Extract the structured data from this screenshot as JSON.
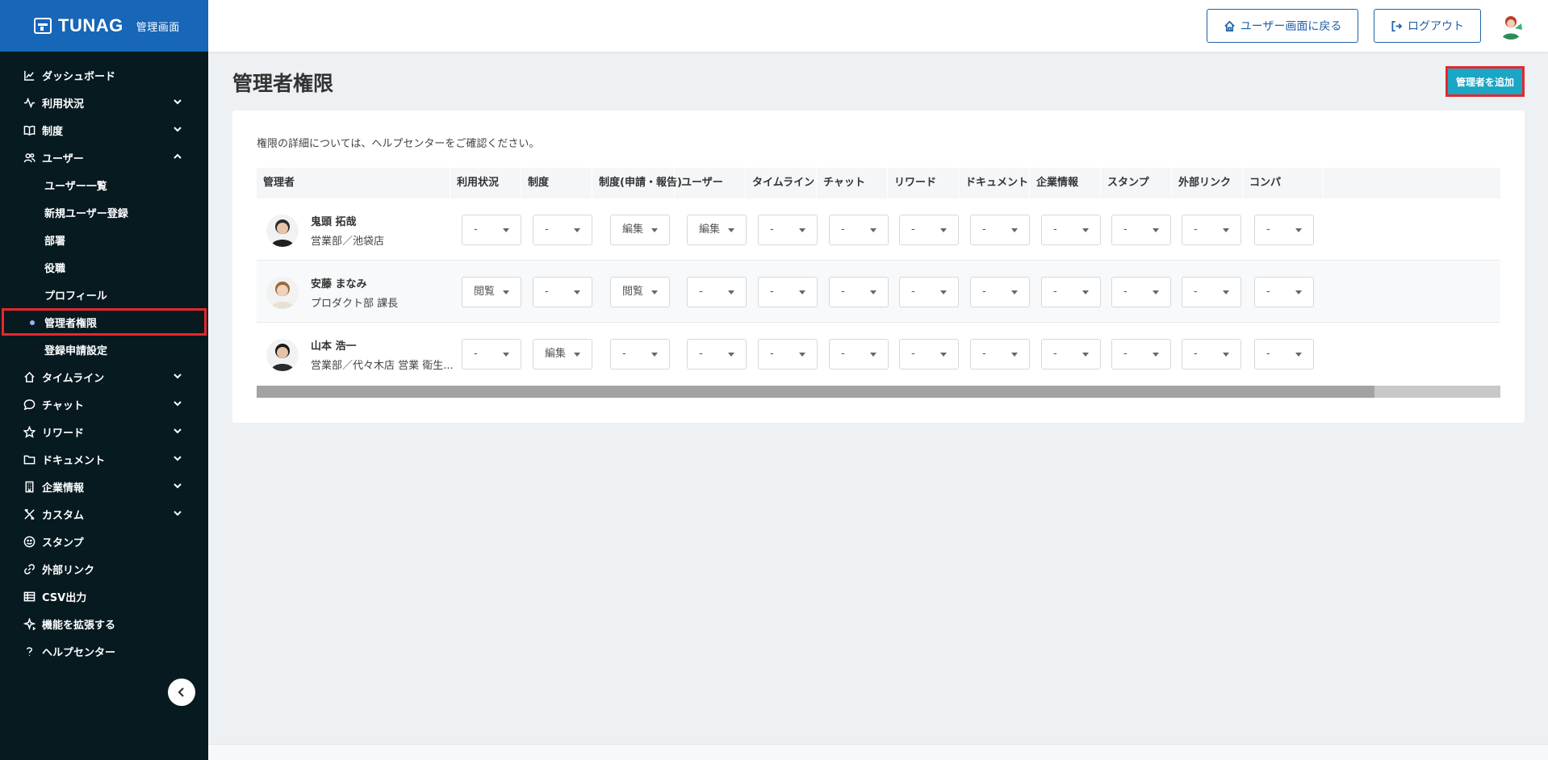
{
  "brand": {
    "name": "TUNAG",
    "sub": "管理画面"
  },
  "sidebar": {
    "items": [
      {
        "label": "ダッシュボード",
        "icon": "chart-line-icon",
        "chevron": ""
      },
      {
        "label": "利用状況",
        "icon": "activity-icon",
        "chevron": "down"
      },
      {
        "label": "制度",
        "icon": "book-icon",
        "chevron": "down"
      },
      {
        "label": "ユーザー",
        "icon": "users-icon",
        "chevron": "up",
        "children": [
          "ユーザー一覧",
          "新規ユーザー登録",
          "部署",
          "役職",
          "プロフィール",
          "管理者権限",
          "登録申請設定"
        ],
        "active_child": 5
      },
      {
        "label": "タイムライン",
        "icon": "home-icon",
        "chevron": "down"
      },
      {
        "label": "チャット",
        "icon": "chat-bubble-icon",
        "chevron": "down"
      },
      {
        "label": "リワード",
        "icon": "star-icon",
        "chevron": "down"
      },
      {
        "label": "ドキュメント",
        "icon": "folder-icon",
        "chevron": "down"
      },
      {
        "label": "企業情報",
        "icon": "building-icon",
        "chevron": "down"
      },
      {
        "label": "カスタム",
        "icon": "tools-icon",
        "chevron": "down"
      },
      {
        "label": "スタンプ",
        "icon": "smile-icon",
        "chevron": ""
      },
      {
        "label": "外部リンク",
        "icon": "link-icon",
        "chevron": ""
      },
      {
        "label": "CSV出力",
        "icon": "table-icon",
        "chevron": ""
      },
      {
        "label": "機能を拡張する",
        "icon": "sparkle-icon",
        "chevron": ""
      },
      {
        "label": "ヘルプセンター",
        "icon": "help-icon",
        "chevron": ""
      }
    ]
  },
  "header": {
    "user_screen_label": "ユーザー画面に戻る",
    "logout_label": "ログアウト"
  },
  "main": {
    "title": "管理者権限",
    "add_button": "管理者を追加",
    "help_text": "権限の詳細については、ヘルプセンターをご確認ください。"
  },
  "table": {
    "columns": [
      "管理者",
      "利用状況",
      "制度",
      "制度(申請・報告)",
      "ユーザー",
      "タイムライン",
      "チャット",
      "リワード",
      "ドキュメント",
      "企業情報",
      "スタンプ",
      "外部リンク",
      "コンパ"
    ],
    "rows": [
      {
        "name": "鬼頭 拓哉",
        "dept": "営業部／池袋店",
        "values": [
          "-",
          "-",
          "編集",
          "編集",
          "-",
          "-",
          "-",
          "-",
          "-",
          "-",
          "-",
          "-"
        ]
      },
      {
        "name": "安藤 まなみ",
        "dept": "プロダクト部 課長",
        "values": [
          "閲覧",
          "-",
          "閲覧",
          "-",
          "-",
          "-",
          "-",
          "-",
          "-",
          "-",
          "-",
          "-"
        ]
      },
      {
        "name": "山本 浩一",
        "dept": "営業部／代々木店 営業 衛生...",
        "values": [
          "-",
          "編集",
          "-",
          "-",
          "-",
          "-",
          "-",
          "-",
          "-",
          "-",
          "-",
          "-"
        ]
      }
    ]
  },
  "scrollbar": {
    "position_fraction": 0.9
  },
  "colors": {
    "sidebar_bg": "#061a20",
    "brand_bg": "#1766b8",
    "accent": "#1aa6c5",
    "highlight": "#e8262d",
    "link": "#2061a8"
  }
}
